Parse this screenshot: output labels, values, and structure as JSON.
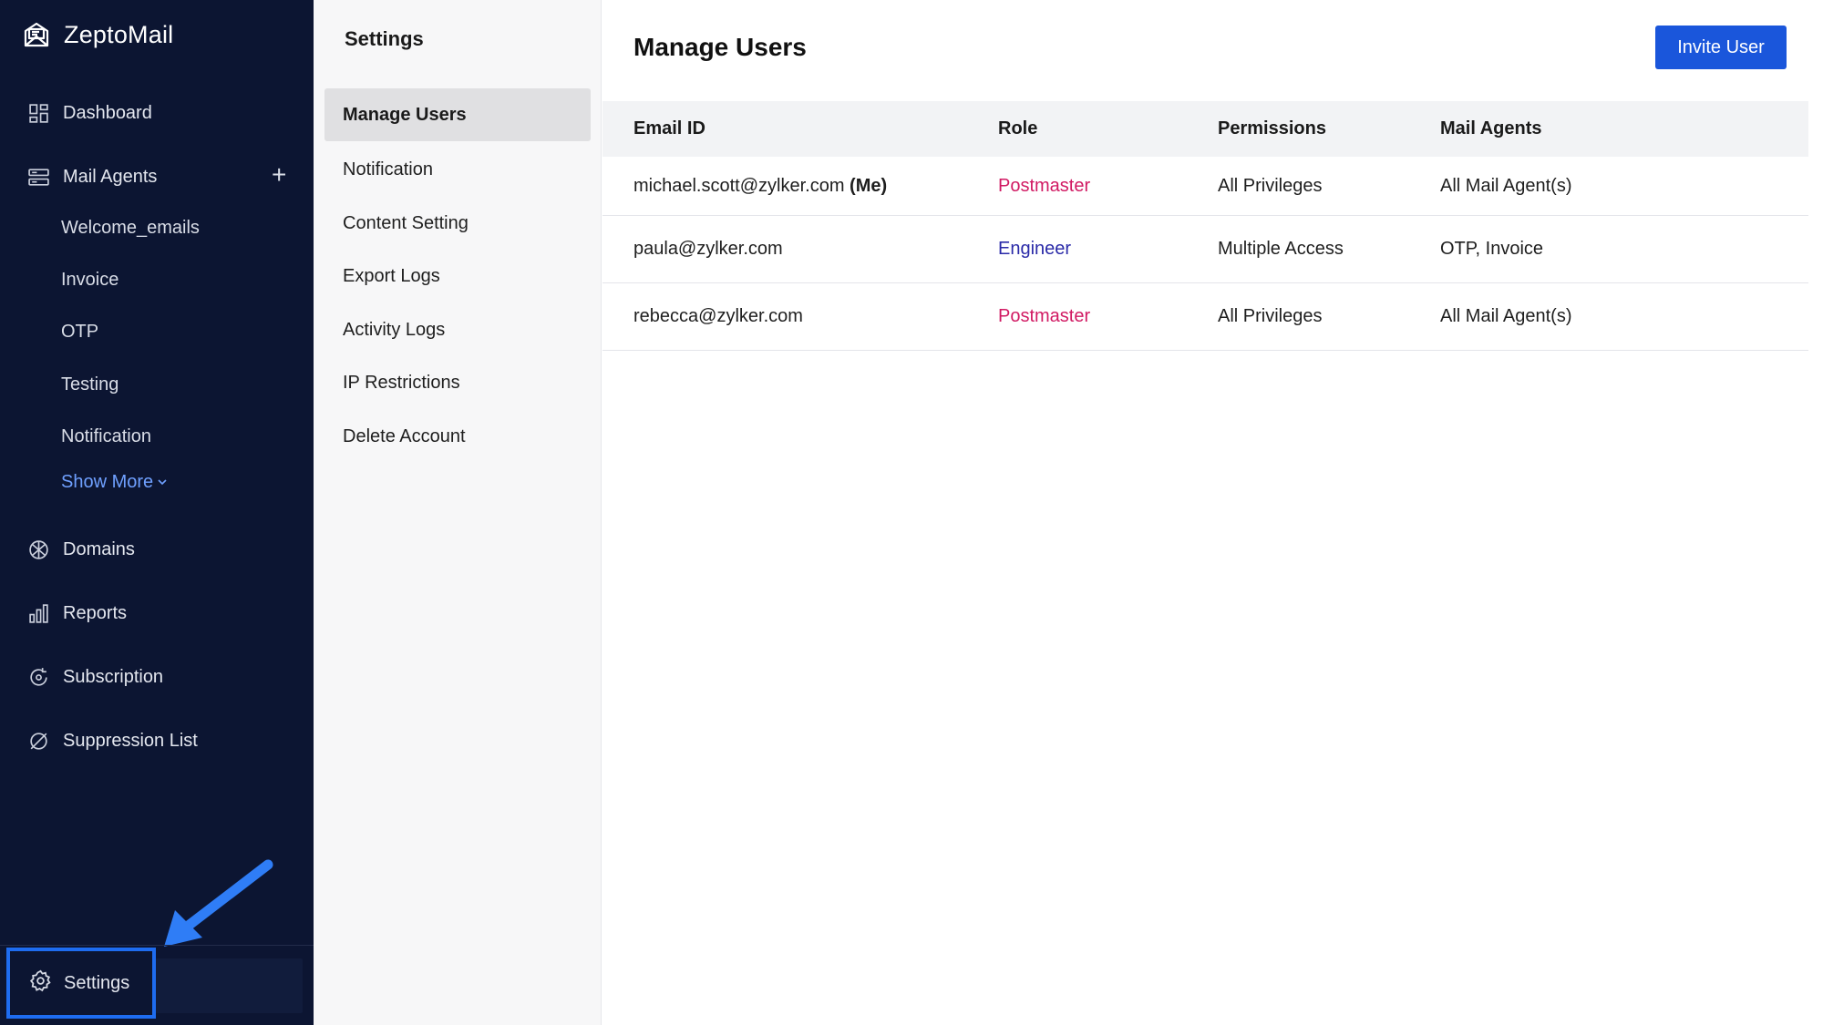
{
  "app": {
    "name": "ZeptoMail"
  },
  "sidebar": {
    "nav": [
      {
        "label": "Dashboard",
        "icon": "dashboard-icon"
      },
      {
        "label": "Mail Agents",
        "icon": "mail-agents-icon"
      },
      {
        "label": "Domains",
        "icon": "domains-icon"
      },
      {
        "label": "Reports",
        "icon": "reports-icon"
      },
      {
        "label": "Subscription",
        "icon": "subscription-icon"
      },
      {
        "label": "Suppression List",
        "icon": "suppression-icon"
      }
    ],
    "mail_agents": [
      "Welcome_emails",
      "Invoice",
      "OTP",
      "Testing",
      "Notification"
    ],
    "show_more": "Show More",
    "settings_label": "Settings"
  },
  "settings_menu": {
    "title": "Settings",
    "items": [
      "Manage Users",
      "Notification",
      "Content Setting",
      "Export Logs",
      "Activity Logs",
      "IP Restrictions",
      "Delete Account"
    ],
    "active": "Manage Users"
  },
  "main": {
    "title": "Manage Users",
    "invite_button": "Invite User",
    "table": {
      "headers": [
        "Email ID",
        "Role",
        "Permissions",
        "Mail Agents"
      ],
      "rows": [
        {
          "email": "michael.scott@zylker.com",
          "me": "(Me)",
          "role": "Postmaster",
          "permissions": "All Privileges",
          "agents": "All Mail Agent(s)"
        },
        {
          "email": "paula@zylker.com",
          "me": "",
          "role": "Engineer",
          "permissions": "Multiple Access",
          "agents": "OTP, Invoice"
        },
        {
          "email": "rebecca@zylker.com",
          "me": "",
          "role": "Postmaster",
          "permissions": "All Privileges",
          "agents": "All Mail Agent(s)"
        }
      ]
    }
  },
  "colors": {
    "sidebar_bg": "#0c1532",
    "accent": "#1a56db",
    "postmaster": "#d11a63",
    "engineer": "#2a2aa8",
    "highlight": "#1e6cf0"
  }
}
